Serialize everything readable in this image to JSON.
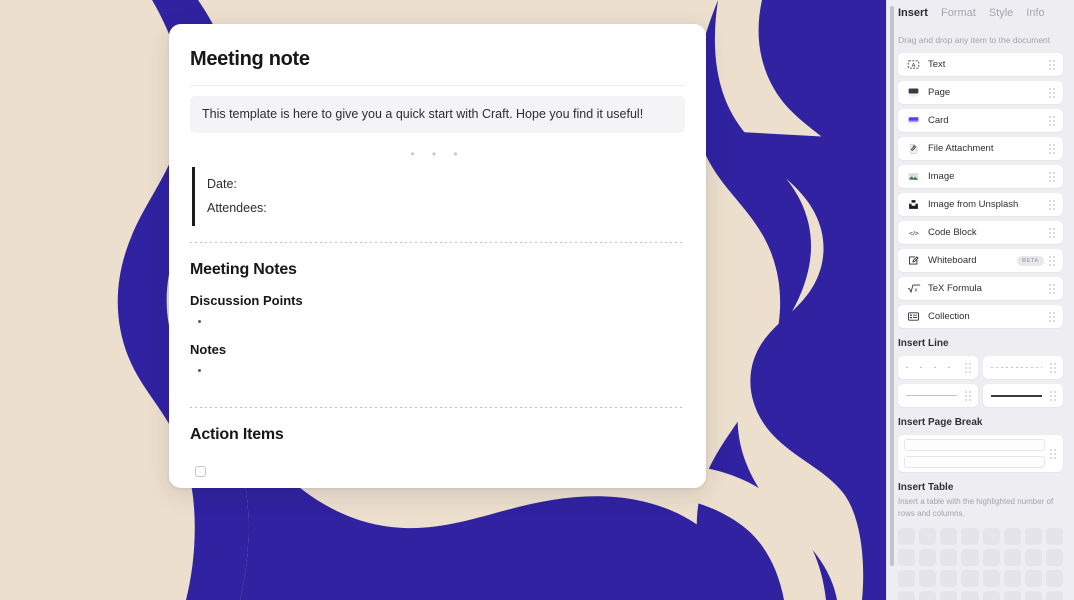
{
  "document": {
    "title": "Meeting note",
    "callout": "This template is here to give you a quick start with Craft. Hope you find it useful!",
    "divider_dots": "• • •",
    "quote_lines": [
      "Date:",
      "Attendees:"
    ],
    "section_meeting_notes": "Meeting Notes",
    "subheading_discussion": "Discussion Points",
    "subheading_notes": "Notes",
    "section_action_items": "Action Items"
  },
  "sidebar": {
    "tabs": [
      {
        "label": "Insert",
        "active": true
      },
      {
        "label": "Format",
        "active": false
      },
      {
        "label": "Style",
        "active": false
      },
      {
        "label": "Info",
        "active": false
      }
    ],
    "hint": "Drag and drop any item to the document",
    "items": [
      {
        "label": "Text",
        "icon": "text-box-icon",
        "badge": ""
      },
      {
        "label": "Page",
        "icon": "page-icon",
        "badge": ""
      },
      {
        "label": "Card",
        "icon": "card-icon",
        "badge": ""
      },
      {
        "label": "File Attachment",
        "icon": "file-attachment-icon",
        "badge": ""
      },
      {
        "label": "Image",
        "icon": "image-icon",
        "badge": ""
      },
      {
        "label": "Image from Unsplash",
        "icon": "unsplash-icon",
        "badge": ""
      },
      {
        "label": "Code Block",
        "icon": "code-block-icon",
        "badge": ""
      },
      {
        "label": "Whiteboard",
        "icon": "whiteboard-icon",
        "badge": "BETA"
      },
      {
        "label": "TeX Formula",
        "icon": "tex-formula-icon",
        "badge": ""
      },
      {
        "label": "Collection",
        "icon": "collection-icon",
        "badge": ""
      }
    ],
    "insert_line": {
      "title": "Insert Line",
      "options": [
        "sparse-dotted-line",
        "dense-dotted-line",
        "thin-solid-line",
        "thick-solid-line"
      ]
    },
    "insert_page_break": {
      "title": "Insert Page Break"
    },
    "insert_table": {
      "title": "Insert Table",
      "description": "Insert a table with the highlighted number of rows and columns.",
      "columns": 8,
      "rows": 4
    }
  },
  "colors": {
    "canvas_beige": "#ecdfcd",
    "artwork_blue": "#3022a0",
    "sidebar_bg": "#eeeef2",
    "card_bg": "#ffffff",
    "accent_purple": "#5b3df5"
  }
}
